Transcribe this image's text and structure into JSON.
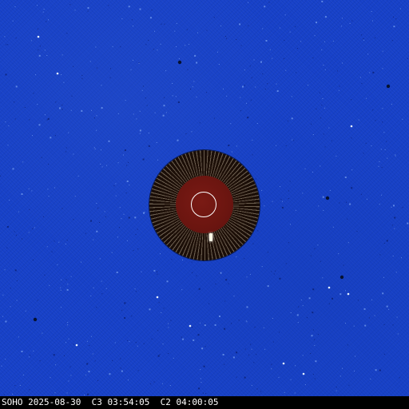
{
  "image": {
    "caption": "SOHO 2025-08-30  C3 03:54:05  C2 04:00:05"
  },
  "colors": {
    "sky": "#1640c8",
    "occulter_ring": "#1c0f08",
    "occulter_disk": "#6b1510",
    "sun_outline": "#ffffff",
    "caption_text": "#ffffff",
    "caption_bar": "#000000"
  }
}
